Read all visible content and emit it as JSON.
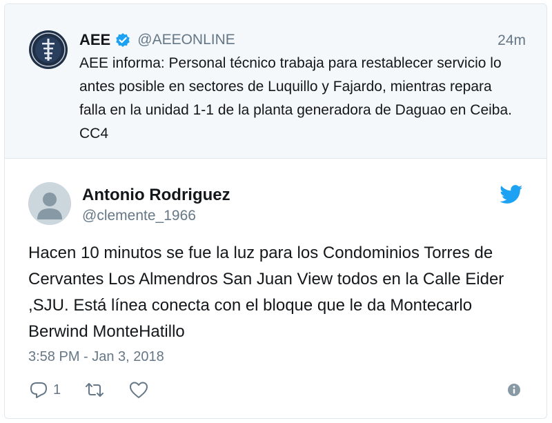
{
  "quoted_tweet": {
    "name": "AEE",
    "handle": "@AEEONLINE",
    "time": "24m",
    "text": "AEE informa: Personal técnico trabaja para restablecer servicio lo antes posible en sectores de Luquillo y Fajardo, mientras repara falla en la unidad 1-1 de la planta generadora de Daguao en Ceiba. CC4",
    "verified": true
  },
  "tweet": {
    "author_name": "Antonio Rodriguez",
    "author_handle": "@clemente_1966",
    "text": "Hacen 10 minutos se fue la luz para los Condominios Torres de Cervantes Los Almendros San Juan View todos en la Calle Eider ,SJU. Está línea conecta con el bloque que le da Montecarlo Berwind MonteHatillo",
    "timestamp": "3:58 PM - Jan 3, 2018",
    "reply_count": "1"
  },
  "icons": {
    "verified": "verified-badge-icon",
    "brand": "twitter-bird-icon",
    "reply": "reply-icon",
    "retweet": "retweet-icon",
    "like": "heart-icon",
    "info": "info-icon"
  },
  "colors": {
    "brand_blue": "#1da1f2",
    "muted_text": "#657786",
    "quoted_bg": "#f5f8fa"
  }
}
